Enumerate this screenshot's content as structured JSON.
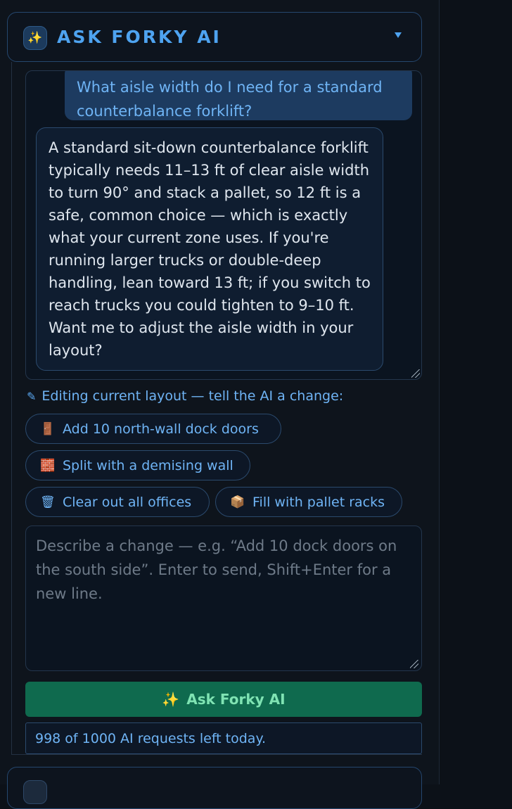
{
  "header": {
    "icon": "sparkles-icon",
    "icon_glyph": "✨",
    "title": "ASK FORKY AI"
  },
  "chat": {
    "user_message": "What aisle width do I need for a standard counterbalance forklift?",
    "ai_message": "A standard sit-down counterbalance forklift typically needs 11–13 ft of clear aisle width to turn 90° and stack a pallet, so 12 ft is a safe, common choice — which is exactly what your current zone uses. If you're running larger trucks or double-deep handling, lean toward 13 ft; if you switch to reach trucks you could tighten to 9–10 ft. Want me to adjust the aisle width in your layout?"
  },
  "editing": {
    "label": "Editing current layout — tell the AI a change:",
    "pencil_glyph": "✎"
  },
  "suggestions": [
    {
      "icon": "door-icon",
      "glyph": "🚪",
      "label": "Add 10 north-wall dock doors"
    },
    {
      "icon": "brick-wall-icon",
      "glyph": "🧱",
      "label": "Split with a demising wall"
    },
    {
      "icon": "trash-icon",
      "glyph": "🗑",
      "label": "Clear out all offices"
    },
    {
      "icon": "package-icon",
      "glyph": "📦",
      "label": "Fill with pallet racks"
    }
  ],
  "input": {
    "placeholder": "Describe a change — e.g. “Add 10 dock doors on the south side”. Enter to send, Shift+Enter for a new line.",
    "value": ""
  },
  "ask_button": {
    "glyph": "✨",
    "label": "Ask Forky AI"
  },
  "quota": {
    "text": "998 of 1000 AI requests left today."
  },
  "colors": {
    "accent": "#4ea3f0",
    "button_bg": "#0f6a4e",
    "button_text": "#7fe3b3"
  }
}
